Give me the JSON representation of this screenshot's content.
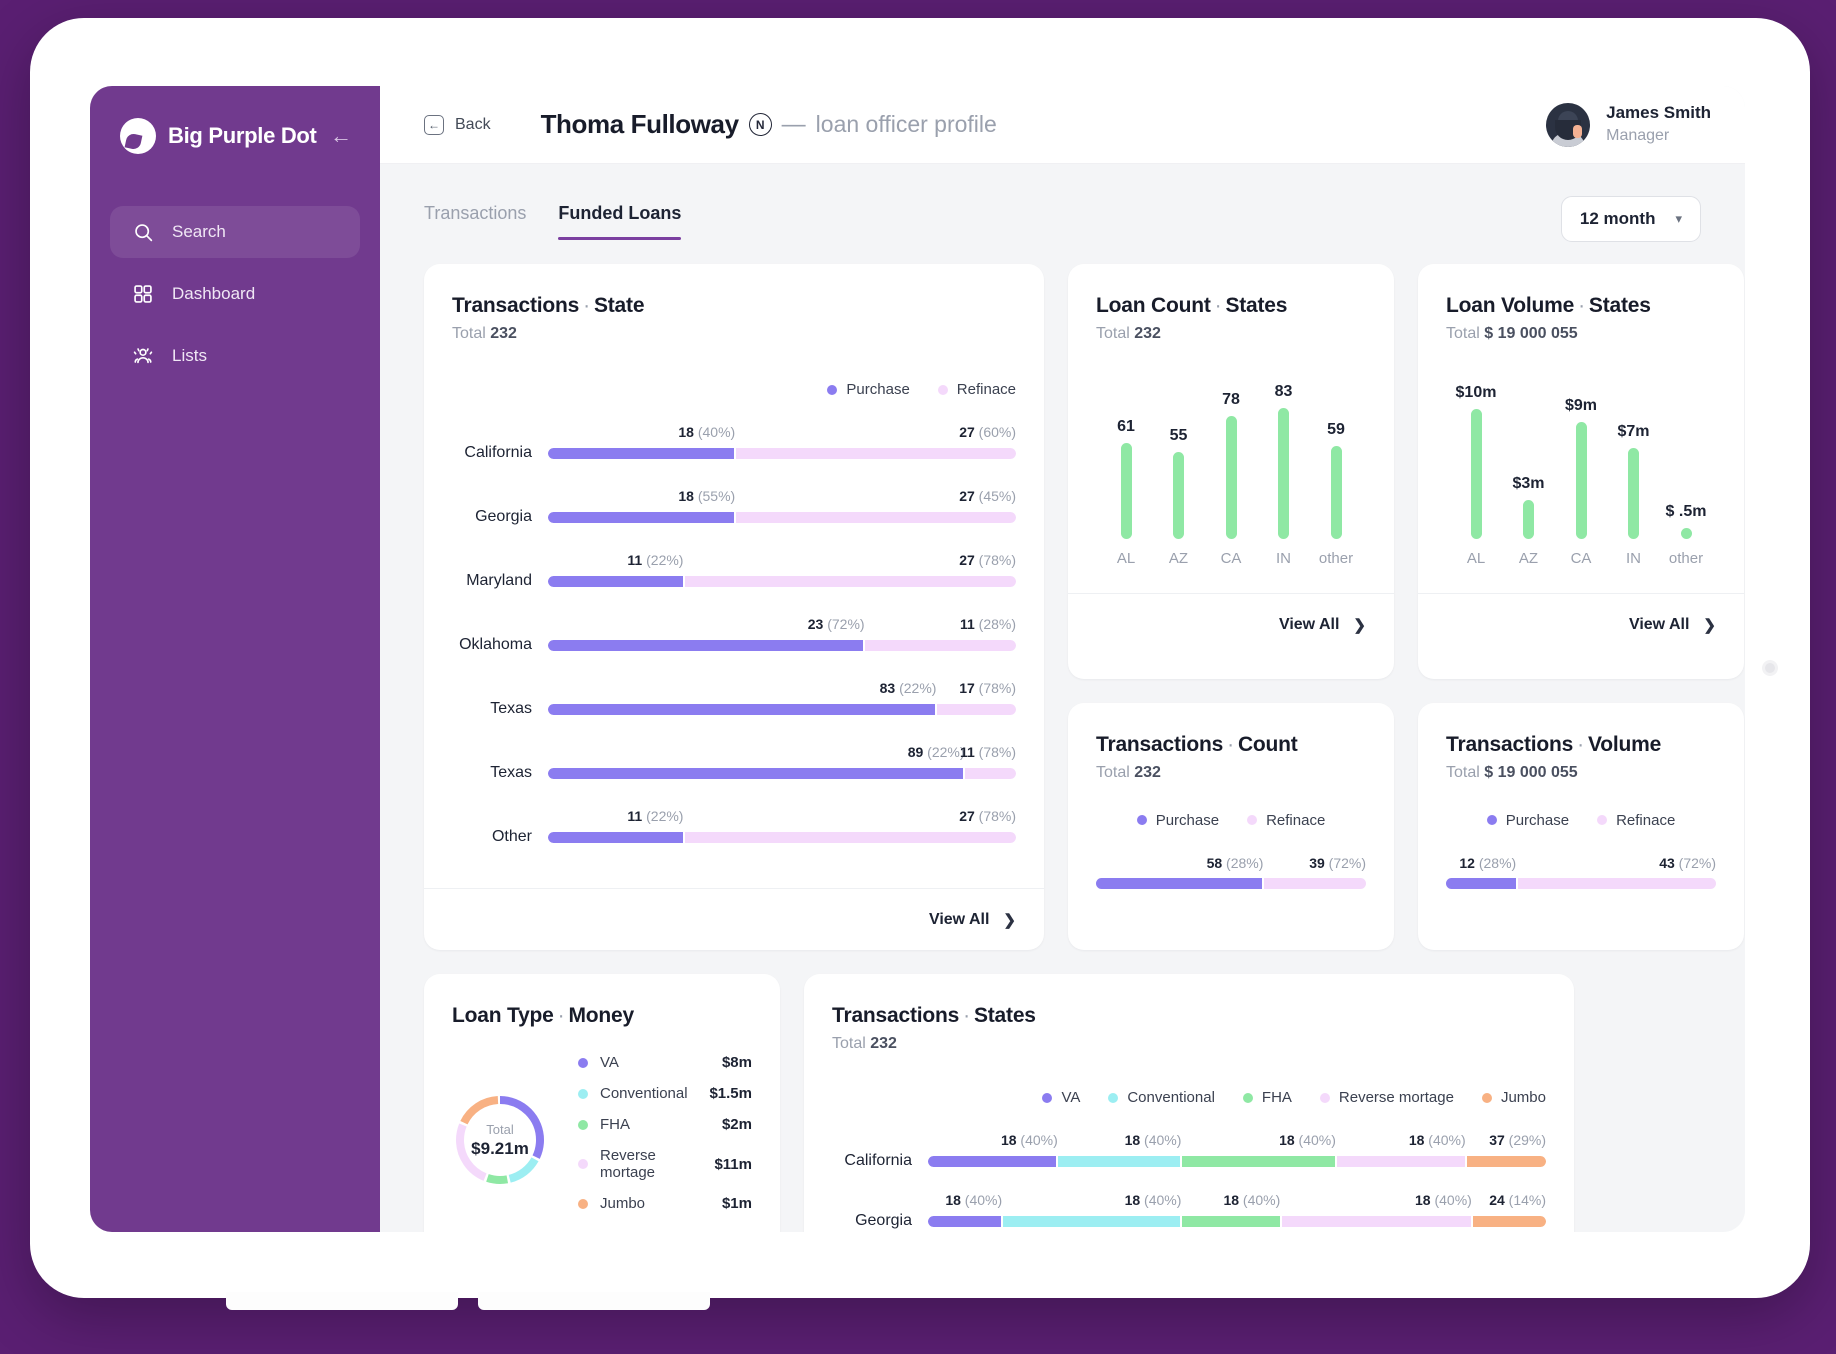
{
  "sidebar": {
    "brand": "Big Purple Dot",
    "collapse_icon": "arrow-left-icon",
    "items": [
      {
        "label": "Search",
        "icon": "search-icon",
        "active": true
      },
      {
        "label": "Dashboard",
        "icon": "grid-icon",
        "active": false
      },
      {
        "label": "Lists",
        "icon": "people-icon",
        "active": false
      }
    ]
  },
  "topbar": {
    "back_label": "Back",
    "back_icon": "arrow-left-circle-icon",
    "profile_name": "Thoma Fulloway",
    "profile_badge": "N",
    "dash": "—",
    "profile_subtitle": "loan officer profile",
    "user_name": "James Smith",
    "user_role": "Manager"
  },
  "tabs": [
    {
      "label": "Transactions",
      "active": false
    },
    {
      "label": "Funded Loans",
      "active": true
    }
  ],
  "period": {
    "label": "12 month",
    "icon": "chevron-down-icon"
  },
  "view_all": "View All",
  "total_label": "Total",
  "colors": {
    "purchase": "#8b7cf0",
    "refinance": "#f4d9fb",
    "green": "#8fe8a4",
    "va": "#8b7cf0",
    "conventional": "#9ceef2",
    "fha": "#8fe8a4",
    "reverse": "#f4d9fb",
    "jumbo": "#f8b183",
    "accent": "#7b3fa0",
    "sidebar": "#713a8e"
  },
  "chart_data": [
    {
      "id": "transactions-state",
      "type": "bar",
      "title_primary": "Transactions",
      "title_secondary": "State",
      "total": "232",
      "legend": [
        {
          "name": "Purchase",
          "color": "#8b7cf0"
        },
        {
          "name": "Refinace",
          "color": "#f4d9fb"
        }
      ],
      "categories": [
        "California",
        "Georgia",
        "Maryland",
        "Oklahoma",
        "Texas",
        "Texas",
        "Other"
      ],
      "rows": [
        {
          "name": "California",
          "segments": [
            {
              "value": 18,
              "pct": 40,
              "label": "18",
              "pct_label": "(40%)",
              "color": "#8b7cf0"
            },
            {
              "value": 27,
              "pct": 60,
              "label": "27",
              "pct_label": "(60%)",
              "color": "#f4d9fb"
            }
          ]
        },
        {
          "name": "Georgia",
          "segments": [
            {
              "value": 18,
              "pct": 55,
              "label": "18",
              "pct_label": "(55%)",
              "color": "#8b7cf0"
            },
            {
              "value": 27,
              "pct": 45,
              "label": "27",
              "pct_label": "(45%)",
              "color": "#f4d9fb"
            }
          ]
        },
        {
          "name": "Maryland",
          "segments": [
            {
              "value": 11,
              "pct": 22,
              "label": "11",
              "pct_label": "(22%)",
              "color": "#8b7cf0"
            },
            {
              "value": 27,
              "pct": 78,
              "label": "27",
              "pct_label": "(78%)",
              "color": "#f4d9fb"
            }
          ]
        },
        {
          "name": "Oklahoma",
          "segments": [
            {
              "value": 23,
              "pct": 72,
              "label": "23",
              "pct_label": "(72%)",
              "color": "#8b7cf0"
            },
            {
              "value": 11,
              "pct": 28,
              "label": "11",
              "pct_label": "(28%)",
              "color": "#f4d9fb"
            }
          ]
        },
        {
          "name": "Texas",
          "segments": [
            {
              "value": 83,
              "pct": 22,
              "label": "83",
              "pct_label": "(22%)",
              "color": "#8b7cf0"
            },
            {
              "value": 17,
              "pct": 78,
              "label": "17",
              "pct_label": "(78%)",
              "color": "#f4d9fb"
            }
          ]
        },
        {
          "name": "Texas",
          "segments": [
            {
              "value": 89,
              "pct": 22,
              "label": "89",
              "pct_label": "(22%)",
              "color": "#8b7cf0"
            },
            {
              "value": 11,
              "pct": 78,
              "label": "11",
              "pct_label": "(78%)",
              "color": "#f4d9fb"
            }
          ]
        },
        {
          "name": "Other",
          "segments": [
            {
              "value": 11,
              "pct": 22,
              "label": "11",
              "pct_label": "(22%)",
              "color": "#8b7cf0"
            },
            {
              "value": 27,
              "pct": 78,
              "label": "27",
              "pct_label": "(78%)",
              "color": "#f4d9fb"
            }
          ]
        }
      ]
    },
    {
      "id": "loan-count-states",
      "type": "bar",
      "title_primary": "Loan Count",
      "title_secondary": "States",
      "total": "232",
      "categories": [
        "AL",
        "AZ",
        "CA",
        "IN",
        "other"
      ],
      "values": [
        61,
        55,
        78,
        83,
        59
      ],
      "value_labels": [
        "61",
        "55",
        "78",
        "83",
        "59"
      ],
      "ylim": [
        0,
        95
      ],
      "color": "#8fe8a4"
    },
    {
      "id": "loan-volume-states",
      "type": "bar",
      "title_primary": "Loan Volume",
      "title_secondary": "States",
      "total": "$ 19 000 055",
      "categories": [
        "AL",
        "AZ",
        "CA",
        "IN",
        "other"
      ],
      "values": [
        10,
        3,
        9,
        7,
        0.5
      ],
      "value_labels": [
        "$10m",
        "$3m",
        "$9m",
        "$7m",
        "$ .5m"
      ],
      "ylim": [
        0,
        11.5
      ],
      "color": "#8fe8a4"
    },
    {
      "id": "transactions-count",
      "type": "bar",
      "title_primary": "Transactions",
      "title_secondary": "Count",
      "total": "232",
      "legend": [
        {
          "name": "Purchase",
          "color": "#8b7cf0"
        },
        {
          "name": "Refinace",
          "color": "#f4d9fb"
        }
      ],
      "segments": [
        {
          "value": 58,
          "pct": 28,
          "label": "58",
          "pct_label": "(28%)",
          "color": "#8b7cf0",
          "width_pct": 62
        },
        {
          "value": 39,
          "pct": 72,
          "label": "39",
          "pct_label": "(72%)",
          "color": "#f4d9fb",
          "width_pct": 38
        }
      ]
    },
    {
      "id": "transactions-volume",
      "type": "bar",
      "title_primary": "Transactions",
      "title_secondary": "Volume",
      "total": "$ 19 000 055",
      "legend": [
        {
          "name": "Purchase",
          "color": "#8b7cf0"
        },
        {
          "name": "Refinace",
          "color": "#f4d9fb"
        }
      ],
      "segments": [
        {
          "value": 12,
          "pct": 28,
          "label": "12",
          "pct_label": "(28%)",
          "color": "#8b7cf0",
          "width_pct": 26
        },
        {
          "value": 43,
          "pct": 72,
          "label": "43",
          "pct_label": "(72%)",
          "color": "#f4d9fb",
          "width_pct": 74
        }
      ]
    },
    {
      "id": "loan-type-money",
      "type": "pie",
      "title_primary": "Loan Type",
      "title_secondary": "Money",
      "center_label": "Total",
      "center_value": "$9.21m",
      "labels": [
        "VA",
        "Conventional",
        "FHA",
        "Reverse mortage",
        "Jumbo"
      ],
      "values": [
        8,
        1.5,
        2,
        11,
        1
      ],
      "value_labels": [
        "$8m",
        "$1.5m",
        "$2m",
        "$11m",
        "$1m"
      ],
      "colors": [
        "#8b7cf0",
        "#9ceef2",
        "#8fe8a4",
        "#f4d9fb",
        "#f8b183"
      ],
      "slice_pcts": [
        33,
        14,
        9,
        26,
        18
      ]
    },
    {
      "id": "transactions-states",
      "type": "bar",
      "title_primary": "Transactions",
      "title_secondary": "States",
      "total": "232",
      "legend": [
        {
          "name": "VA",
          "color": "#8b7cf0"
        },
        {
          "name": "Conventional",
          "color": "#9ceef2"
        },
        {
          "name": "FHA",
          "color": "#8fe8a4"
        },
        {
          "name": "Reverse mortage",
          "color": "#f4d9fb"
        },
        {
          "name": "Jumbo",
          "color": "#f8b183"
        }
      ],
      "rows": [
        {
          "name": "California",
          "segments": [
            {
              "label": "18",
              "pct_label": "(40%)",
              "color": "#8b7cf0",
              "width_pct": 21
            },
            {
              "label": "18",
              "pct_label": "(40%)",
              "color": "#9ceef2",
              "width_pct": 20
            },
            {
              "label": "18",
              "pct_label": "(40%)",
              "color": "#8fe8a4",
              "width_pct": 25
            },
            {
              "label": "18",
              "pct_label": "(40%)",
              "color": "#f4d9fb",
              "width_pct": 21
            },
            {
              "label": "37",
              "pct_label": "(29%)",
              "color": "#f8b183",
              "width_pct": 13
            }
          ]
        },
        {
          "name": "Georgia",
          "segments": [
            {
              "label": "18",
              "pct_label": "(40%)",
              "color": "#8b7cf0",
              "width_pct": 12
            },
            {
              "label": "18",
              "pct_label": "(40%)",
              "color": "#9ceef2",
              "width_pct": 29
            },
            {
              "label": "18",
              "pct_label": "(40%)",
              "color": "#8fe8a4",
              "width_pct": 16
            },
            {
              "label": "18",
              "pct_label": "(40%)",
              "color": "#f4d9fb",
              "width_pct": 31
            },
            {
              "label": "24",
              "pct_label": "(14%)",
              "color": "#f8b183",
              "width_pct": 12
            }
          ]
        }
      ]
    }
  ]
}
